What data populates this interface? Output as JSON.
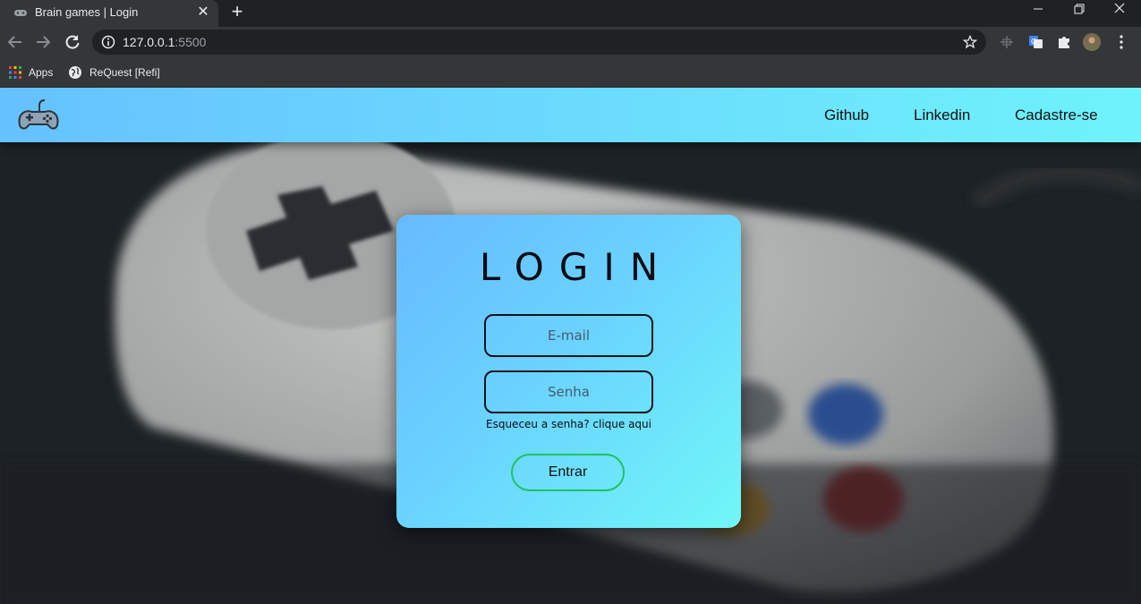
{
  "browser": {
    "tab_title": "Brain games | Login",
    "tab_close": "✕",
    "new_tab": "+",
    "url_host": "127.0.0.1",
    "url_port": ":5500",
    "bookmarks": [
      {
        "label": "Apps",
        "icon": "apps-grid-icon"
      },
      {
        "label": "ReQuest [Refi]",
        "icon": "globe-icon"
      }
    ]
  },
  "header": {
    "nav": [
      {
        "label": "Github"
      },
      {
        "label": "Linkedin"
      },
      {
        "label": "Cadastre-se"
      }
    ],
    "gradient_start": "#66c1ff",
    "gradient_end": "#6ff3fb"
  },
  "login": {
    "title": "LOGIN",
    "email_placeholder": "E-mail",
    "password_placeholder": "Senha",
    "forgot_text": "Esqueceu a senha? clique aqui",
    "submit_label": "Entrar",
    "button_border_color": "#22c065"
  }
}
